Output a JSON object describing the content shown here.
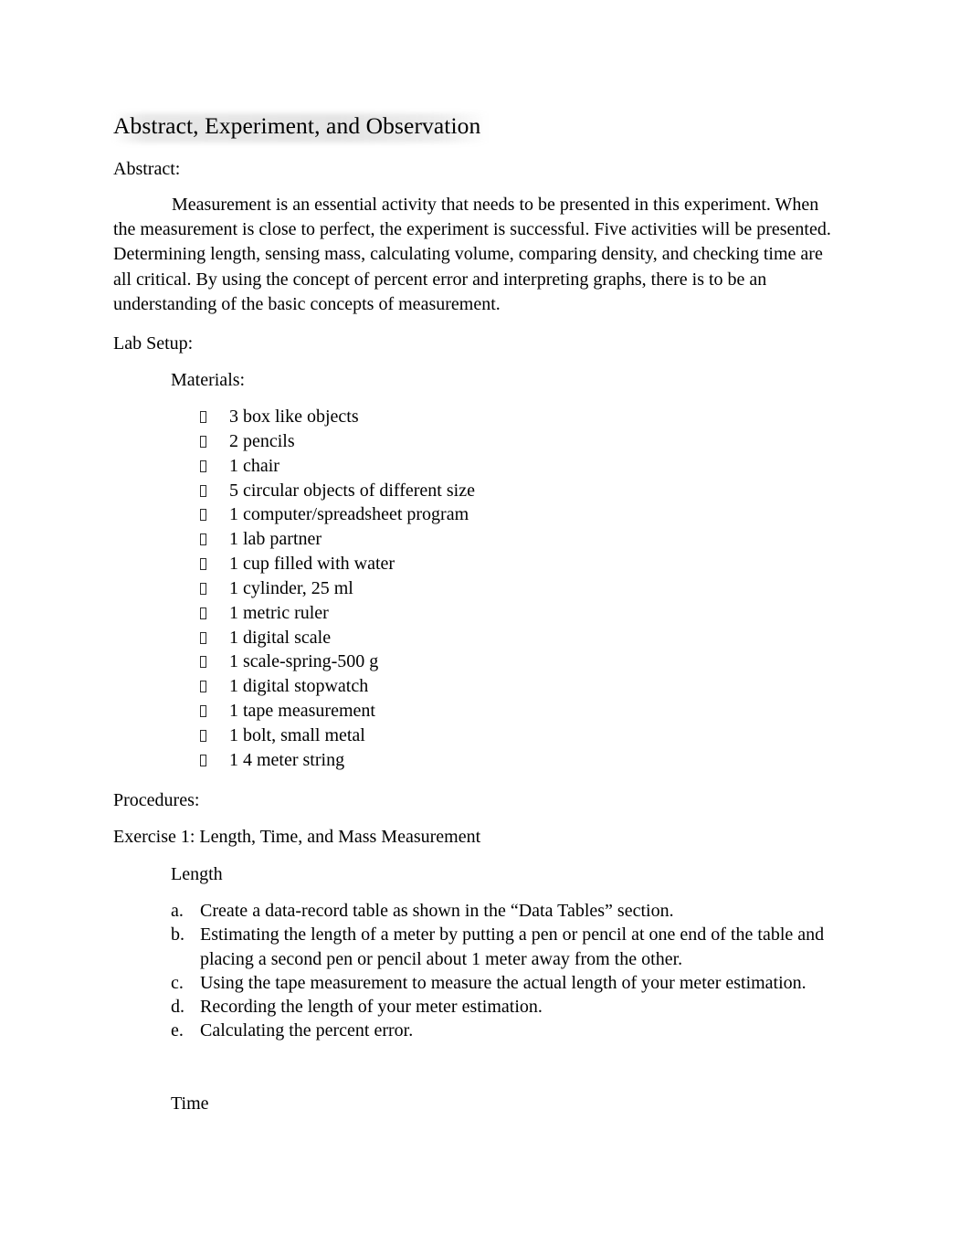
{
  "document": {
    "title": "Abstract, Experiment, and Observation",
    "sections": {
      "abstract_heading": "Abstract:",
      "abstract_body": "Measurement is an essential activity that needs to be presented in this experiment. When the measurement is close to perfect, the experiment is successful. Five activities will be presented. Determining length, sensing mass, calculating volume, comparing density, and checking time are all critical. By using the concept of percent error and interpreting graphs, there is to be an understanding of the basic concepts of measurement.",
      "lab_setup_heading": "Lab Setup:",
      "materials_heading": "Materials:",
      "procedures_heading": "Procedures:",
      "exercise_heading": "Exercise 1: Length, Time, and Mass Measurement",
      "length_subheading": "Length",
      "time_subheading": "Time"
    },
    "materials": [
      "3 box like objects",
      "2 pencils",
      "1 chair",
      "5 circular objects of different size",
      "1 computer/spreadsheet program",
      "1 lab partner",
      "1 cup filled with water",
      "1 cylinder, 25 ml",
      "1 metric ruler",
      "1 digital scale",
      "1 scale-spring-500 g",
      "1 digital stopwatch",
      "1 tape measurement",
      "1 bolt, small metal",
      "1 4 meter string"
    ],
    "length_steps": [
      {
        "marker": "a.",
        "text": "Create a data-record table as shown in the “Data Tables” section."
      },
      {
        "marker": "b.",
        "text": "Estimating the length of a meter by putting a pen or pencil at one end of the table and placing a second pen or pencil about 1 meter away from the other."
      },
      {
        "marker": "c.",
        "text": "Using the tape measurement to measure the actual length of your meter estimation."
      },
      {
        "marker": "d.",
        "text": "Recording the length of your meter estimation."
      },
      {
        "marker": "e.",
        "text": "Calculating the percent error."
      }
    ]
  }
}
